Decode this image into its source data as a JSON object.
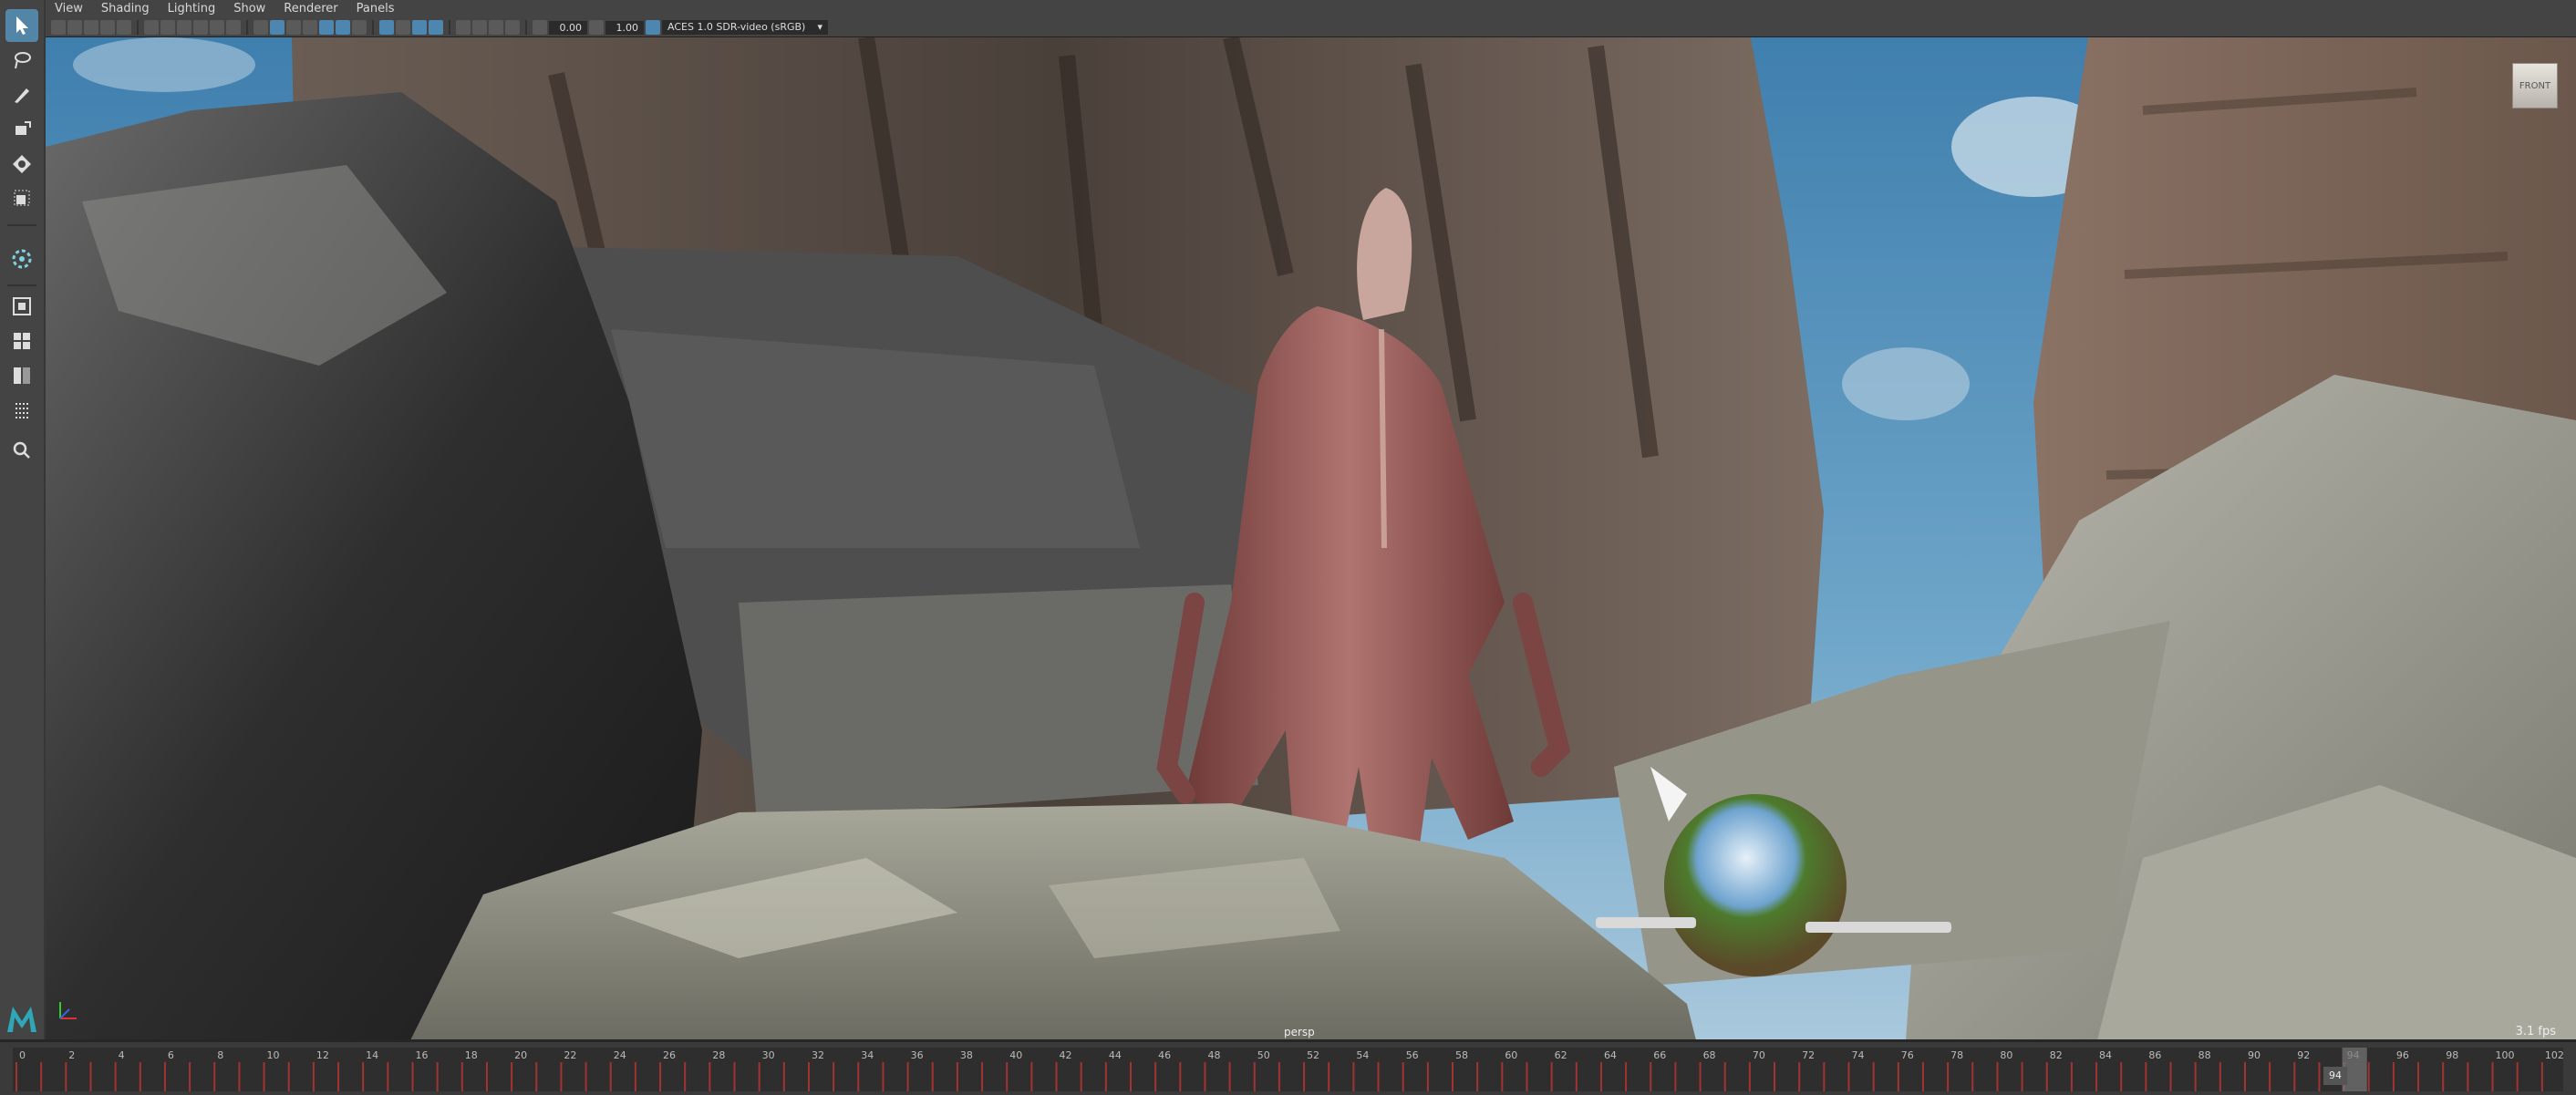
{
  "menu": {
    "items": [
      "View",
      "Shading",
      "Lighting",
      "Show",
      "Renderer",
      "Panels"
    ]
  },
  "toolbar": {
    "exposure": "0.00",
    "gamma": "1.00",
    "color_management": "ACES 1.0 SDR-video (sRGB)"
  },
  "toolbox": {
    "tools": [
      "select-tool",
      "lasso-tool",
      "paint-select-tool",
      "move-tool",
      "rotate-tool",
      "scale-tool",
      "universal-manipulator",
      "layout-toggle",
      "layout-single",
      "layout-four",
      "layout-two",
      "layout-outliner",
      "search"
    ],
    "logo": "maya-logo"
  },
  "viewport": {
    "view_cube_label": "FRONT",
    "camera_label": "persp",
    "fps": "3.1 fps"
  },
  "timeline": {
    "labels": [
      "0",
      "2",
      "4",
      "6",
      "8",
      "10",
      "12",
      "14",
      "16",
      "18",
      "20",
      "22",
      "24",
      "26",
      "28",
      "30",
      "32",
      "34",
      "36",
      "38",
      "40",
      "42",
      "44",
      "46",
      "48",
      "50",
      "52",
      "54",
      "56",
      "58",
      "60",
      "62",
      "64",
      "66",
      "68",
      "70",
      "72",
      "74",
      "76",
      "78",
      "80",
      "82",
      "84",
      "86",
      "88",
      "90",
      "92",
      "94",
      "96",
      "98",
      "100",
      "102"
    ],
    "current_frame": "94"
  },
  "colors": {
    "accent": "#5285a6",
    "panel": "#444444",
    "keyframe": "#a33333"
  }
}
